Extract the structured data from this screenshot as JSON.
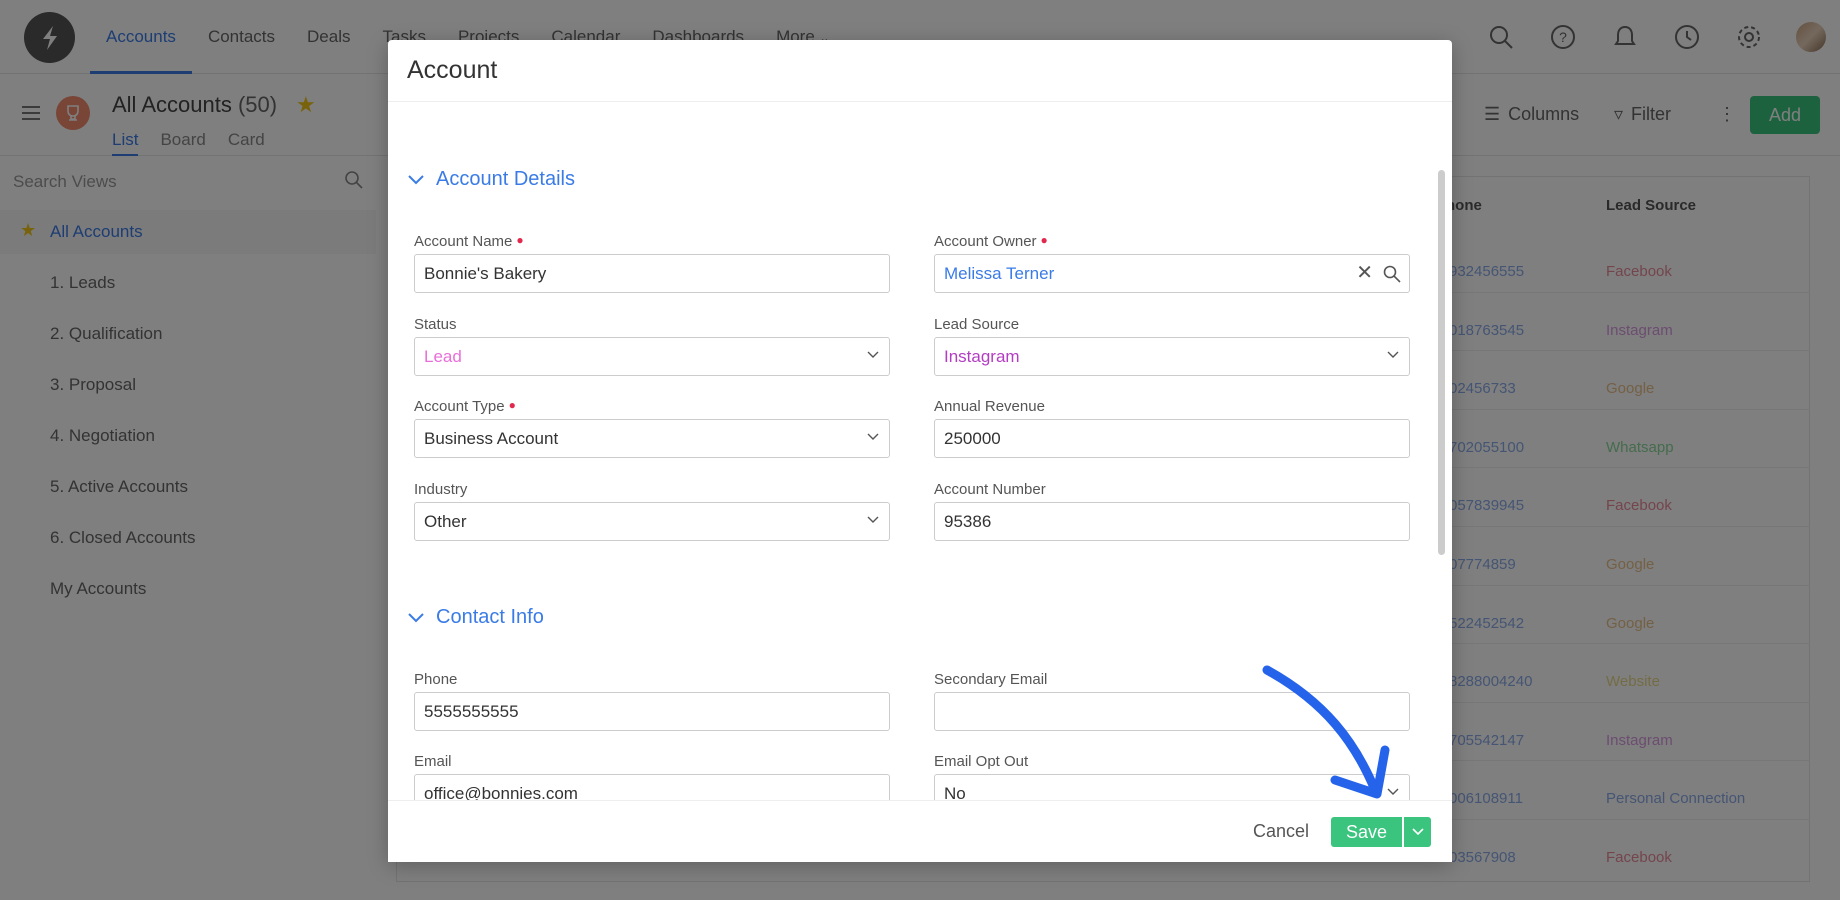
{
  "nav": {
    "items": [
      "Accounts",
      "Contacts",
      "Deals",
      "Tasks",
      "Projects",
      "Calendar",
      "Dashboards",
      "More"
    ]
  },
  "header": {
    "title": "All Accounts",
    "count": "(50)",
    "view_tabs": [
      "List",
      "Board",
      "Card"
    ],
    "columns_label": "Columns",
    "filter_label": "Filter",
    "add_label": "Add"
  },
  "sidebar": {
    "search_placeholder": "Search Views",
    "items": [
      "All Accounts",
      "1. Leads",
      "2. Qualification",
      "3. Proposal",
      "4. Negotiation",
      "5. Active Accounts",
      "6. Closed Accounts",
      "My Accounts"
    ]
  },
  "table": {
    "headers": [
      "hone",
      "Lead Source"
    ],
    "rows": [
      {
        "phone": "932456555",
        "source": "Facebook",
        "color": "#e88a9a"
      },
      {
        "phone": "018763545",
        "source": "Instagram",
        "color": "#d89ae0"
      },
      {
        "phone": "02456733",
        "source": "Google",
        "color": "#e8c08a"
      },
      {
        "phone": "702055100",
        "source": "Whatsapp",
        "color": "#8ad89a"
      },
      {
        "phone": "057839945",
        "source": "Facebook",
        "color": "#e88a9a"
      },
      {
        "phone": "07774859",
        "source": "Google",
        "color": "#e8c08a"
      },
      {
        "phone": "522452542",
        "source": "Google",
        "color": "#e8c08a"
      },
      {
        "phone": "8288004240",
        "source": "Website",
        "color": "#e8d88a"
      },
      {
        "phone": "705542147",
        "source": "Instagram",
        "color": "#d89ae0"
      },
      {
        "phone": "006108911",
        "source": "Personal Connection",
        "color": "#8aaae8"
      },
      {
        "phone": "03567908",
        "source": "Facebook",
        "color": "#e88a9a"
      }
    ]
  },
  "modal": {
    "title": "Account",
    "sections": {
      "details": "Account Details",
      "contact": "Contact Info"
    },
    "fields": {
      "account_name": {
        "label": "Account Name",
        "value": "Bonnie's Bakery"
      },
      "account_owner": {
        "label": "Account Owner",
        "value": "Melissa Terner"
      },
      "status": {
        "label": "Status",
        "value": "Lead"
      },
      "lead_source": {
        "label": "Lead Source",
        "value": "Instagram"
      },
      "account_type": {
        "label": "Account Type",
        "value": "Business Account"
      },
      "annual_revenue": {
        "label": "Annual Revenue",
        "value": "250000"
      },
      "industry": {
        "label": "Industry",
        "value": "Other"
      },
      "account_number": {
        "label": "Account Number",
        "value": "95386"
      },
      "phone": {
        "label": "Phone",
        "value": "5555555555"
      },
      "secondary_email": {
        "label": "Secondary Email",
        "value": ""
      },
      "email": {
        "label": "Email",
        "value": "office@bonnies.com"
      },
      "email_opt_out": {
        "label": "Email Opt Out",
        "value": "No"
      }
    },
    "footer": {
      "cancel": "Cancel",
      "save": "Save"
    }
  },
  "colors": {
    "accent": "#3a7be6",
    "save": "#3ac47d",
    "status_lead": "#e86fd8",
    "lead_source_instagram": "#b43cc4",
    "owner_link": "#3a7be6",
    "required": "#e0294d",
    "arrow": "#2563eb"
  }
}
